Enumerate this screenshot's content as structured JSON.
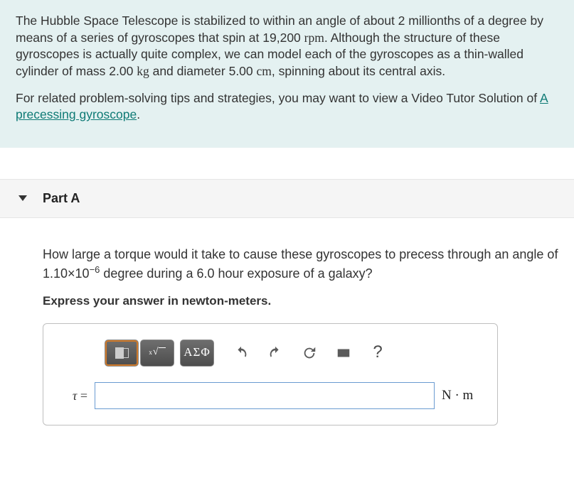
{
  "intro": {
    "p1_a": "The Hubble Space Telescope is stabilized to within an angle of about 2 millionths of a degree by means of a series of gyroscopes that spin at 19,200 ",
    "p1_rpm": "rpm",
    "p1_b": ". Although the structure of these gyroscopes is actually quite complex, we can model each of the gyroscopes as a thin-walled cylinder of mass 2.00 ",
    "p1_kg": "kg",
    "p1_c": " and diameter 5.00 ",
    "p1_cm": "cm",
    "p1_d": ", spinning about its central axis.",
    "p2_a": "For related problem-solving tips and strategies, you may want to view a Video Tutor Solution of ",
    "p2_link": "A precessing gyroscope",
    "p2_b": "."
  },
  "part": {
    "label": "Part A",
    "question_a": "How large a torque would it take to cause these gyroscopes to precess through an angle of 1.10×10",
    "question_exp": "−6",
    "question_b": " degree during a 6.0 hour exposure of a galaxy?",
    "instruction": "Express your answer in newton-meters.",
    "greek_btn": "ΑΣΦ",
    "help_btn": "?",
    "lhs_sym": "τ",
    "lhs_eq": " = ",
    "unit": "N · m",
    "answer_value": ""
  }
}
